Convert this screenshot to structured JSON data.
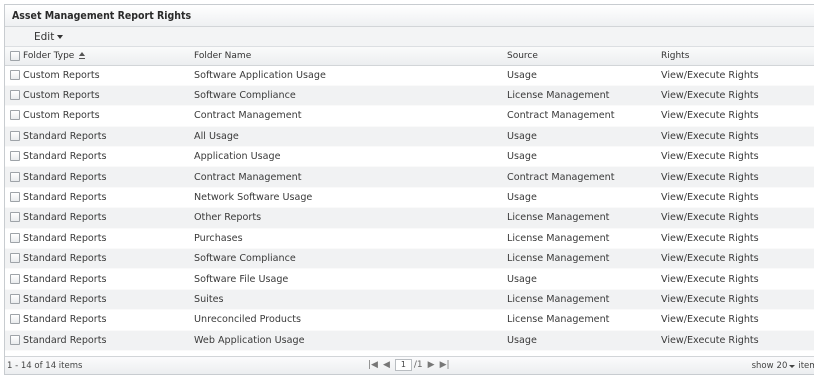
{
  "panel": {
    "title": "Asset Management Report Rights"
  },
  "toolbar": {
    "edit_label": "Edit"
  },
  "table": {
    "columns": {
      "folder_type": "Folder Type",
      "folder_name": "Folder Name",
      "source": "Source",
      "rights": "Rights"
    },
    "rows": [
      {
        "type": "Custom Reports",
        "name": "Software Application Usage",
        "source": "Usage",
        "rights": "View/Execute Rights"
      },
      {
        "type": "Custom Reports",
        "name": "Software Compliance",
        "source": "License Management",
        "rights": "View/Execute Rights"
      },
      {
        "type": "Custom Reports",
        "name": "Contract Management",
        "source": "Contract Management",
        "rights": "View/Execute Rights"
      },
      {
        "type": "Standard Reports",
        "name": "All Usage",
        "source": "Usage",
        "rights": "View/Execute Rights"
      },
      {
        "type": "Standard Reports",
        "name": "Application Usage",
        "source": "Usage",
        "rights": "View/Execute Rights"
      },
      {
        "type": "Standard Reports",
        "name": "Contract Management",
        "source": "Contract Management",
        "rights": "View/Execute Rights"
      },
      {
        "type": "Standard Reports",
        "name": "Network Software Usage",
        "source": "Usage",
        "rights": "View/Execute Rights"
      },
      {
        "type": "Standard Reports",
        "name": "Other Reports",
        "source": "License Management",
        "rights": "View/Execute Rights"
      },
      {
        "type": "Standard Reports",
        "name": "Purchases",
        "source": "License Management",
        "rights": "View/Execute Rights"
      },
      {
        "type": "Standard Reports",
        "name": "Software Compliance",
        "source": "License Management",
        "rights": "View/Execute Rights"
      },
      {
        "type": "Standard Reports",
        "name": "Software File Usage",
        "source": "Usage",
        "rights": "View/Execute Rights"
      },
      {
        "type": "Standard Reports",
        "name": "Suites",
        "source": "License Management",
        "rights": "View/Execute Rights"
      },
      {
        "type": "Standard Reports",
        "name": "Unreconciled Products",
        "source": "License Management",
        "rights": "View/Execute Rights"
      },
      {
        "type": "Standard Reports",
        "name": "Web Application Usage",
        "source": "Usage",
        "rights": "View/Execute Rights"
      }
    ]
  },
  "footer": {
    "count_text": "1 - 14 of 14 items",
    "first_page": "|◀",
    "prev_page": "◀",
    "current_page": "1",
    "total_pages": "/1",
    "next_page": "▶",
    "last_page": "▶|",
    "page_size_prefix": "show",
    "page_size_value": "20",
    "page_size_suffix": "items"
  }
}
